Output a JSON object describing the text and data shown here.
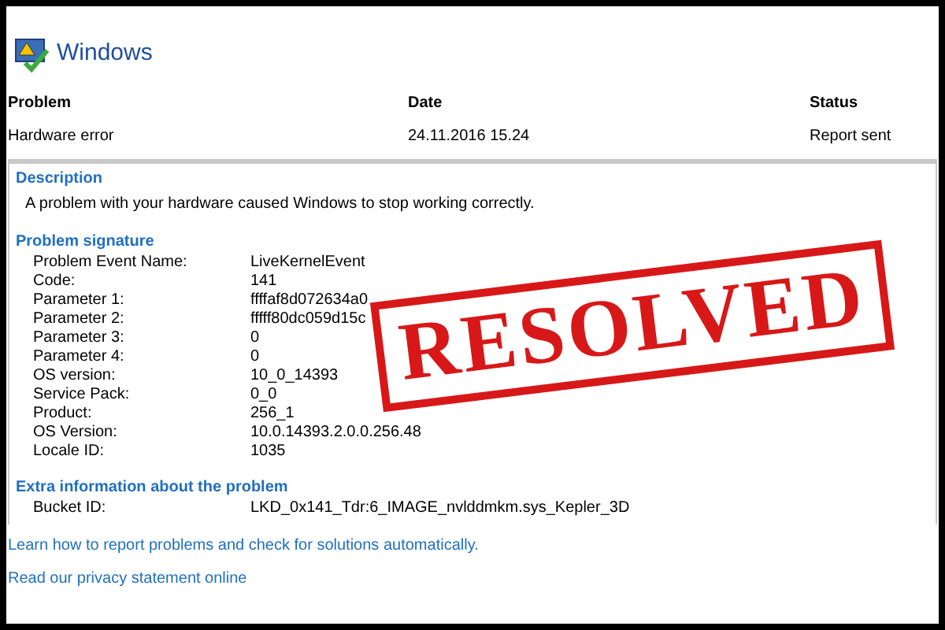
{
  "header": {
    "title": "Windows"
  },
  "table": {
    "columns": [
      "Problem",
      "Date",
      "Status"
    ],
    "row": [
      "Hardware error",
      "24.11.2016 15.24",
      "Report sent"
    ]
  },
  "details": {
    "description_heading": "Description",
    "description": "A problem with your hardware caused Windows to stop working correctly.",
    "signature_heading": "Problem signature",
    "signature": [
      {
        "label": "Problem Event Name:",
        "value": "LiveKernelEvent"
      },
      {
        "label": "Code:",
        "value": "141"
      },
      {
        "label": "Parameter 1:",
        "value": "ffffaf8d072634a0"
      },
      {
        "label": "Parameter 2:",
        "value": "fffff80dc059d15c"
      },
      {
        "label": "Parameter 3:",
        "value": "0"
      },
      {
        "label": "Parameter 4:",
        "value": "0"
      },
      {
        "label": "OS version:",
        "value": "10_0_14393"
      },
      {
        "label": "Service Pack:",
        "value": "0_0"
      },
      {
        "label": "Product:",
        "value": "256_1"
      },
      {
        "label": "OS Version:",
        "value": "10.0.14393.2.0.0.256.48"
      },
      {
        "label": "Locale ID:",
        "value": "1035"
      }
    ],
    "extra_heading": "Extra information about the problem",
    "extra": [
      {
        "label": "Bucket ID:",
        "value": "LKD_0x141_Tdr:6_IMAGE_nvlddmkm.sys_Kepler_3D"
      }
    ]
  },
  "links": [
    "Learn how to report problems and check for solutions automatically.",
    "Read our privacy statement online"
  ],
  "stamp": "RESOLVED"
}
